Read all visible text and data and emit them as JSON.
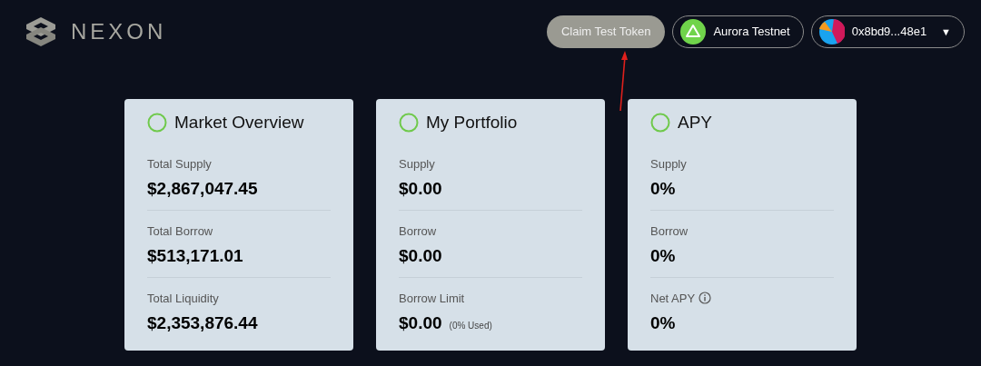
{
  "header": {
    "logo_text": "NEXON",
    "claim_button": "Claim Test Token",
    "network": "Aurora Testnet",
    "wallet": {
      "address": "0x8bd9...48e1",
      "caret": "▼"
    }
  },
  "cards": [
    {
      "title": "Market Overview",
      "rows": [
        {
          "label": "Total Supply",
          "value": "$2,867,047.45",
          "info_icon": false
        },
        {
          "label": "Total Borrow",
          "value": "$513,171.01",
          "info_icon": false
        },
        {
          "label": "Total Liquidity",
          "value": "$2,353,876.44",
          "info_icon": false
        }
      ]
    },
    {
      "title": "My Portfolio",
      "rows": [
        {
          "label": "Supply",
          "value": "$0.00",
          "info_icon": false
        },
        {
          "label": "Borrow",
          "value": "$0.00",
          "info_icon": false
        },
        {
          "label": "Borrow Limit",
          "value": "$0.00",
          "note": "(0% Used)",
          "info_icon": false
        }
      ]
    },
    {
      "title": "APY",
      "rows": [
        {
          "label": "Supply",
          "value": "0%",
          "info_icon": false
        },
        {
          "label": "Borrow",
          "value": "0%",
          "info_icon": false
        },
        {
          "label": "Net APY",
          "value": "0%",
          "info_icon": true
        }
      ]
    }
  ]
}
